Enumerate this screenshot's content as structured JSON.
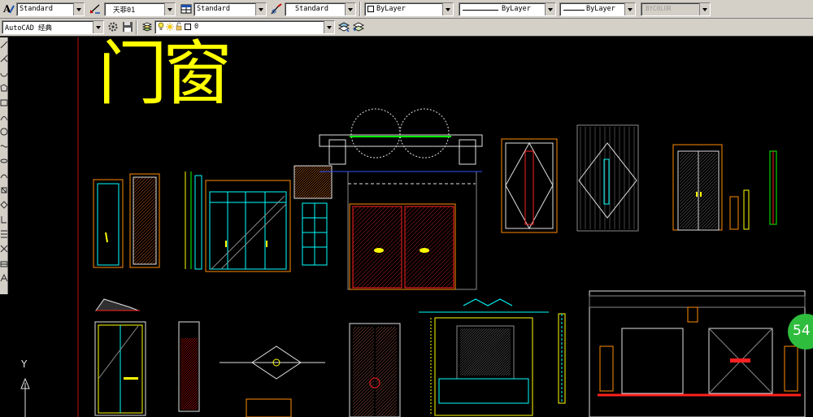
{
  "toolbar_styles": {
    "text_style": "Standard",
    "dim_style": "天菲01",
    "table_style": "Standard",
    "multileader_style": "Standard"
  },
  "toolbar_properties": {
    "color": "ByLayer",
    "linetype": "ByLayer",
    "lineweight": "ByLayer",
    "plot_style": "BYCOLOR"
  },
  "toolbar_workspace": {
    "workspace": "AutoCAD 经典",
    "layer": "0"
  },
  "drawing": {
    "title": "门窗",
    "ucs_y_label": "Y"
  },
  "notification": {
    "count": "54"
  },
  "colors": {
    "title": "#ffff00",
    "canvas": "#000000",
    "toolbar": "#d4d0c8"
  }
}
